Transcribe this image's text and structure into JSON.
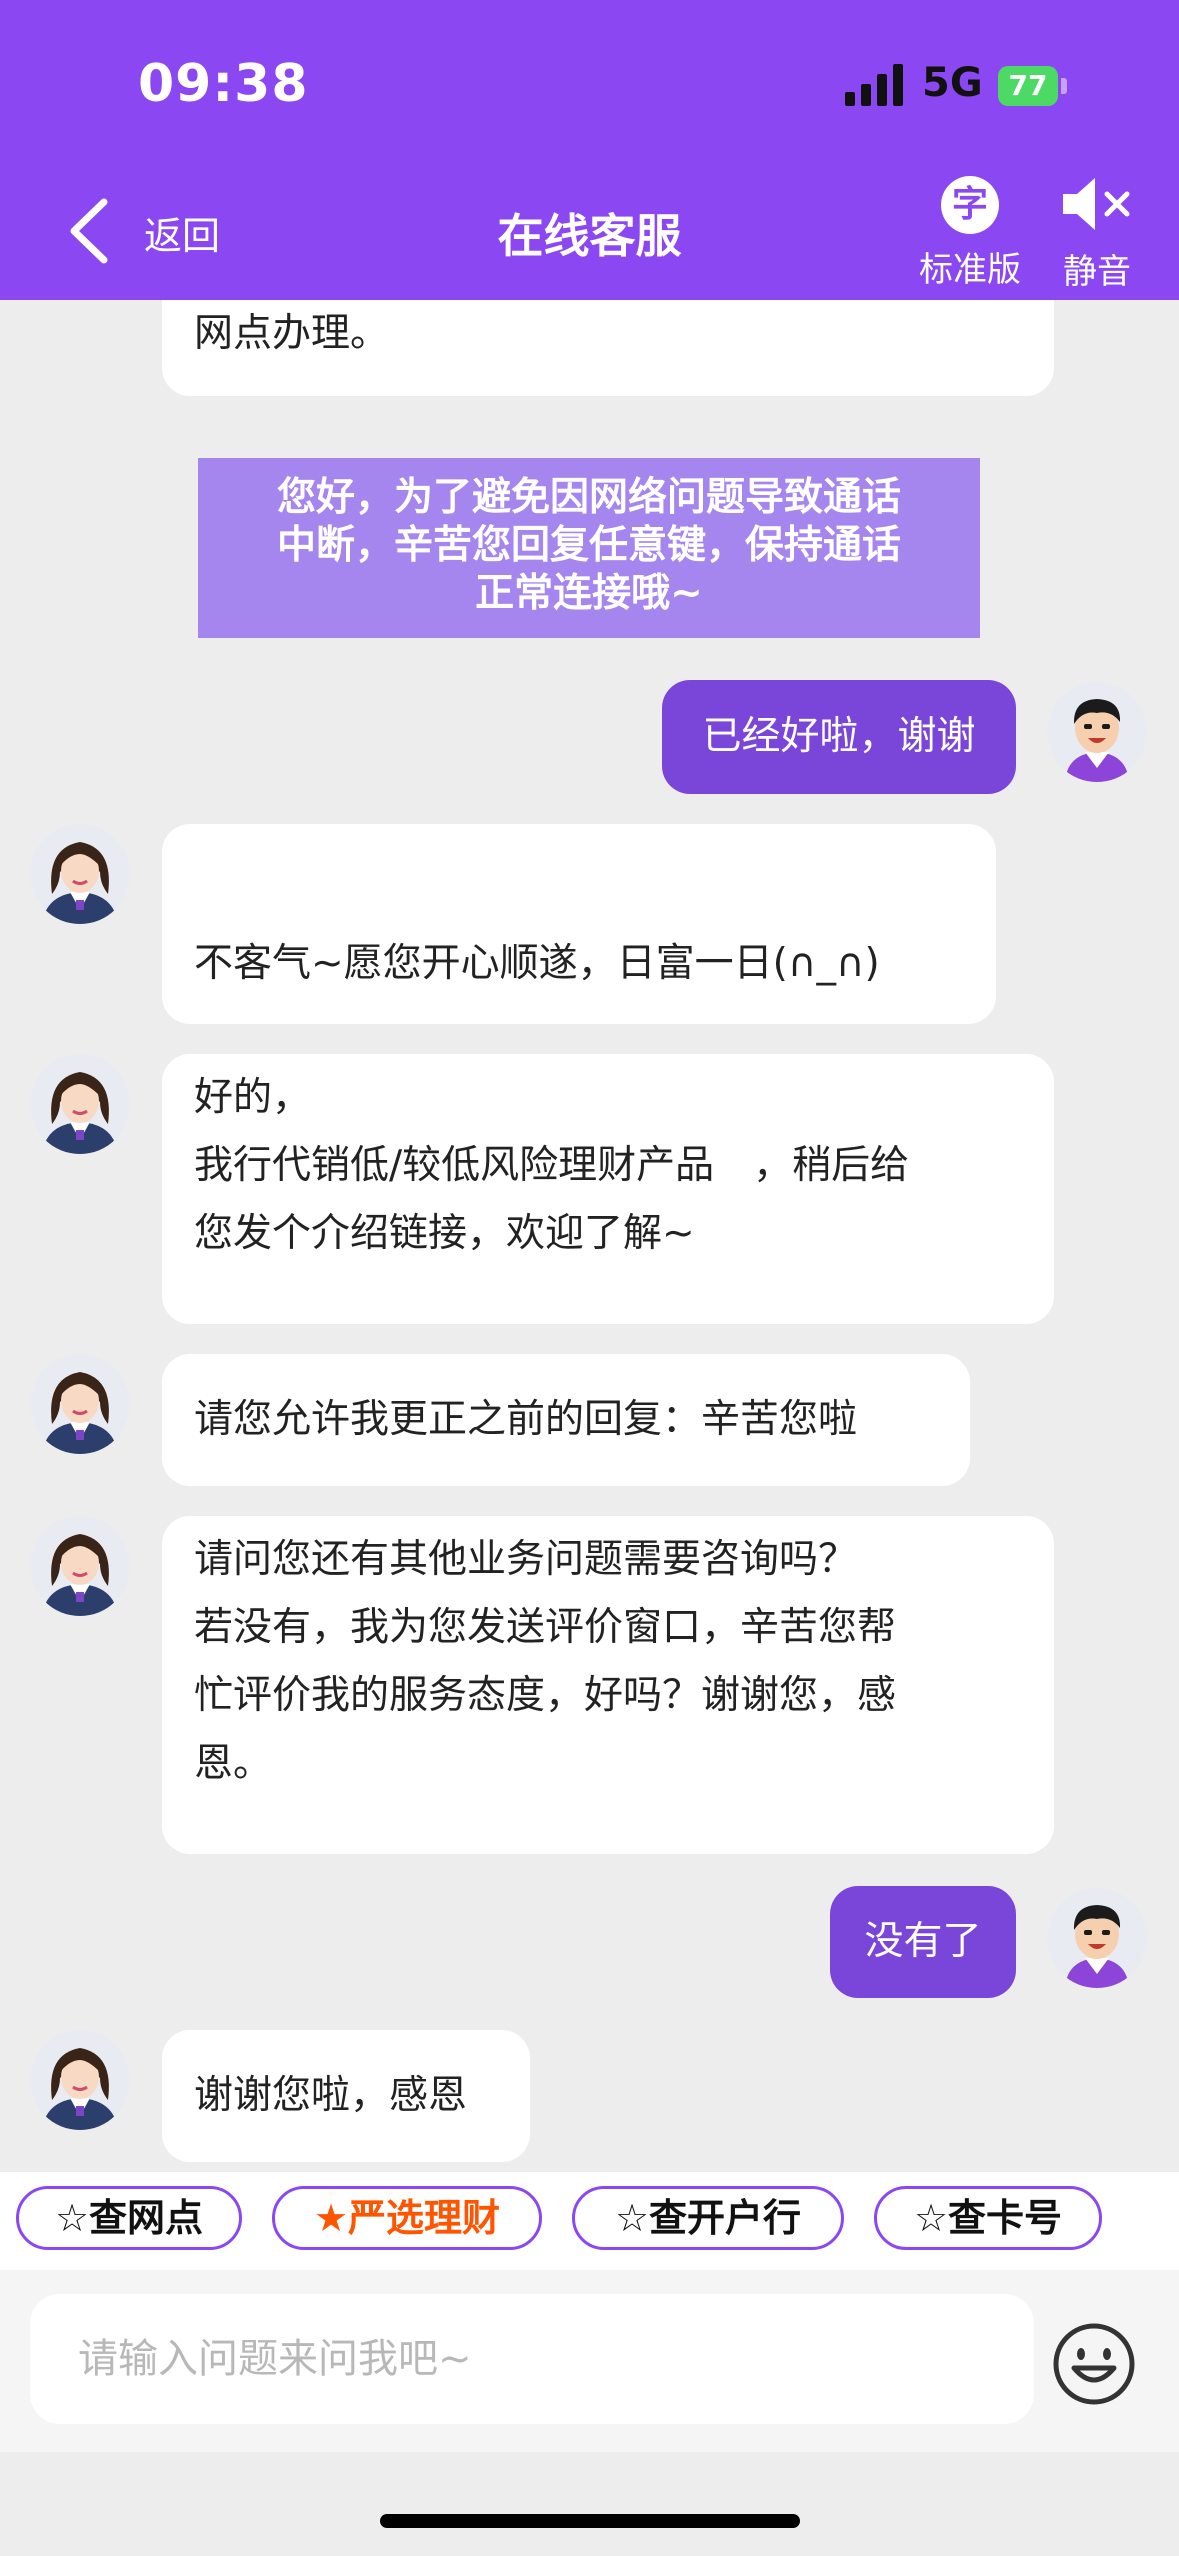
{
  "status_bar": {
    "time": "09:38",
    "network": "5G",
    "battery": "77"
  },
  "header": {
    "back_label": "返回",
    "title": "在线客服",
    "mode_icon_char": "字",
    "mode_label": "标准版",
    "mute_label": "静音"
  },
  "messages": {
    "m0": "网点办理。",
    "notice": [
      "您好，为了避免因网络问题导致通话",
      "中断，辛苦您回复任意键，保持通话",
      "正常连接哦~"
    ],
    "u1": "已经好啦，谢谢",
    "a1": "不客气~愿您开心顺遂，日富一日(∩_∩)",
    "a2": [
      "好的，",
      "我行代销低/较低风险理财产品　，稍后给",
      "您发个介绍链接，欢迎了解~"
    ],
    "a3": "请您允许我更正之前的回复：辛苦您啦",
    "a4": [
      "请问您还有其他业务问题需要咨询吗？",
      "若没有，我为您发送评价窗口，辛苦您帮",
      "忙评价我的服务态度，好吗？谢谢您，感",
      "恩。"
    ],
    "u2": "没有了",
    "a5": "谢谢您啦，感恩"
  },
  "quick_chips": [
    "☆查网点",
    "★严选理财",
    "☆查开户行",
    "☆查卡号"
  ],
  "input": {
    "placeholder": "请输入问题来问我吧~"
  },
  "colors": {
    "header": "#8b47f2",
    "user_bubble": "#7a46da",
    "notice": "#a585ee",
    "hot_chip": "#ff5500"
  }
}
